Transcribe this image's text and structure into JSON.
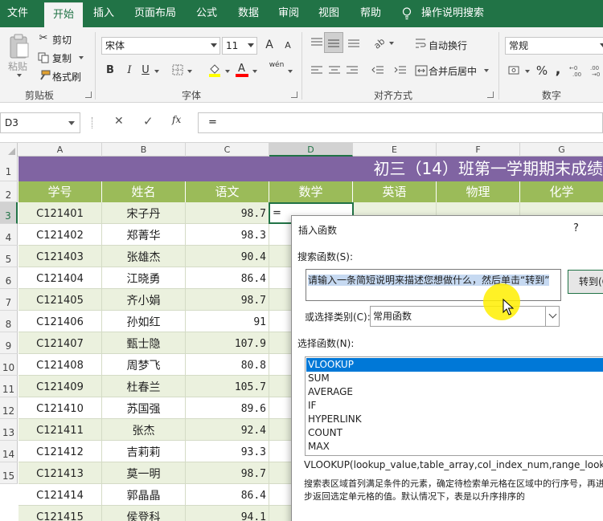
{
  "ribbon_tabs": [
    "文件",
    "开始",
    "插入",
    "页面布局",
    "公式",
    "数据",
    "审阅",
    "视图",
    "帮助",
    "操作说明搜索"
  ],
  "active_tab": "开始",
  "clipboard": {
    "paste_label": "粘贴",
    "cut_label": "剪切",
    "copy_label": "复制",
    "format_painter_label": "格式刷",
    "group_label": "剪贴板"
  },
  "font": {
    "name": "宋体",
    "size": "11",
    "increase_label": "A",
    "decrease_label": "A",
    "bold": "B",
    "italic": "I",
    "underline": "U",
    "font_color_glyph": "A",
    "phonetic_glyph": "wén",
    "group_label": "字体"
  },
  "alignment": {
    "wrap_label": "自动换行",
    "merge_label": "合并后居中",
    "group_label": "对齐方式"
  },
  "number": {
    "format": "常规",
    "percent": "%",
    "comma": ",",
    "group_label": "数字"
  },
  "formula_bar": {
    "name_box": "D3",
    "cancel_glyph": "✕",
    "enter_glyph": "✓",
    "fx_glyph": "fx",
    "content": "="
  },
  "colors": {
    "ribbon": "#217346",
    "title_row": "#8064a2",
    "header_row": "#9bbb59",
    "data_odd": "#ebf1de",
    "data_even": "#ffffff",
    "list_selection": "#0078d7"
  },
  "sheet": {
    "column_letters": [
      "A",
      "B",
      "C",
      "D",
      "E",
      "F",
      "G"
    ],
    "selected_column": "D",
    "row_numbers": [
      "1",
      "2",
      "3",
      "4",
      "5",
      "6",
      "7",
      "8",
      "9",
      "10",
      "11",
      "12",
      "13",
      "14",
      "15"
    ],
    "selected_row": "3",
    "title": "初三（14）班第一学期期末成绩",
    "headers": [
      "学号",
      "姓名",
      "语文",
      "数学",
      "英语",
      "物理",
      "化学"
    ],
    "active_cell_content": "=",
    "rows": [
      {
        "id": "C121401",
        "name": "宋子丹",
        "chinese": "98.7"
      },
      {
        "id": "C121402",
        "name": "郑菁华",
        "chinese": "98.3"
      },
      {
        "id": "C121403",
        "name": "张雄杰",
        "chinese": "90.4"
      },
      {
        "id": "C121404",
        "name": "江晓勇",
        "chinese": "86.4"
      },
      {
        "id": "C121405",
        "name": "齐小娟",
        "chinese": "98.7"
      },
      {
        "id": "C121406",
        "name": "孙如红",
        "chinese": "91"
      },
      {
        "id": "C121407",
        "name": "甄士隐",
        "chinese": "107.9"
      },
      {
        "id": "C121408",
        "name": "周梦飞",
        "chinese": "80.8"
      },
      {
        "id": "C121409",
        "name": "杜春兰",
        "chinese": "105.7"
      },
      {
        "id": "C121410",
        "name": "苏国强",
        "chinese": "89.6"
      },
      {
        "id": "C121411",
        "name": "张杰",
        "chinese": "92.4"
      },
      {
        "id": "C121412",
        "name": "吉莉莉",
        "chinese": "93.3"
      },
      {
        "id": "C121413",
        "name": "莫一明",
        "chinese": "98.7"
      },
      {
        "id": "C121414",
        "name": "郭晶晶",
        "chinese": "86.4"
      },
      {
        "id": "C121415",
        "name": "侯登科",
        "chinese": "94.1"
      }
    ]
  },
  "dialog": {
    "title": "插入函数",
    "help": "?",
    "search_label": "搜索函数(S):",
    "search_value": "请输入一条简短说明来描述您想做什么，然后单击“转到”",
    "goto_label": "转到(G)",
    "category_label": "或选择类别(C):",
    "category_value": "常用函数",
    "select_label": "选择函数(N):",
    "functions": [
      "VLOOKUP",
      "SUM",
      "AVERAGE",
      "IF",
      "HYPERLINK",
      "COUNT",
      "MAX"
    ],
    "selected_function": "VLOOKUP",
    "signature": "VLOOKUP(lookup_value,table_array,col_index_num,range_lookup)",
    "description": "搜索表区域首列满足条件的元素，确定待检索单元格在区域中的行序号，再进一步返回选定单元格的值。默认情况下，表是以升序排序的"
  }
}
